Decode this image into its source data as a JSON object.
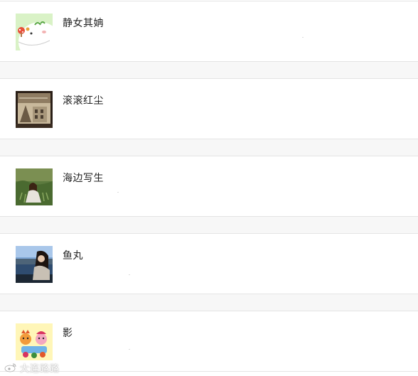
{
  "contacts": [
    {
      "name": "静女其姌",
      "avatar_icon": "cartoon-mushroom-avatar"
    },
    {
      "name": "滚滚红尘",
      "avatar_icon": "sketch-building-avatar"
    },
    {
      "name": "海边写生",
      "avatar_icon": "person-in-grass-avatar"
    },
    {
      "name": "鱼丸",
      "avatar_icon": "girl-by-lake-avatar"
    },
    {
      "name": "影",
      "avatar_icon": "cartoon-figures-avatar"
    }
  ],
  "watermark": {
    "text": "大连路路",
    "icon": "weibo-logo-icon"
  }
}
